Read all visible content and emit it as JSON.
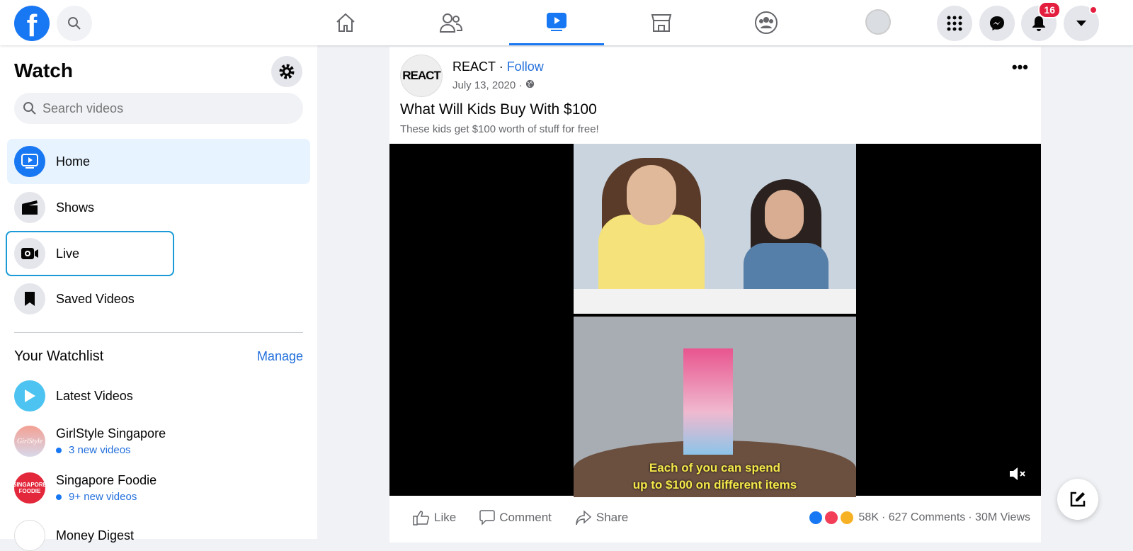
{
  "topbar": {
    "logo": "f",
    "notifications_count": "16",
    "nav": [
      {
        "icon": "home-icon"
      },
      {
        "icon": "friends-icon"
      },
      {
        "icon": "watch-icon",
        "active": true
      },
      {
        "icon": "marketplace-icon"
      },
      {
        "icon": "groups-icon"
      }
    ]
  },
  "sidebar": {
    "title": "Watch",
    "search_placeholder": "Search videos",
    "items": [
      {
        "label": "Home",
        "icon": "watch-icon",
        "selected": true
      },
      {
        "label": "Shows",
        "icon": "clapper-icon"
      },
      {
        "label": "Live",
        "icon": "live-camera-icon"
      },
      {
        "label": "Saved Videos",
        "icon": "bookmark-icon"
      }
    ],
    "watchlist_title": "Your Watchlist",
    "manage": "Manage",
    "latest": "Latest Videos",
    "channels": [
      {
        "name": "GirlStyle Singapore",
        "sub": "3 new videos",
        "logo": "GirlStyle"
      },
      {
        "name": "Singapore Foodie",
        "sub": "9+ new videos",
        "logo": "SINGAPORE FOODIE"
      },
      {
        "name": "Money Digest"
      }
    ]
  },
  "post": {
    "page": "REACT",
    "avatar_text": "REACT",
    "follow": "Follow",
    "date": "July 13, 2020 · ",
    "title": "What Will Kids Buy With $100",
    "subtitle": "These kids get $100 worth of stuff for free!",
    "caption_line1": "Each of you can spend",
    "caption_line2": "up to $100 on different items",
    "like": "Like",
    "comment": "Comment",
    "share": "Share",
    "reactions": "58K",
    "comments": "· 627 Comments",
    "views": "· 30M Views"
  },
  "colors": {
    "brand": "#1877f2",
    "link": "#216fdb",
    "badge": "#e41e3f"
  }
}
